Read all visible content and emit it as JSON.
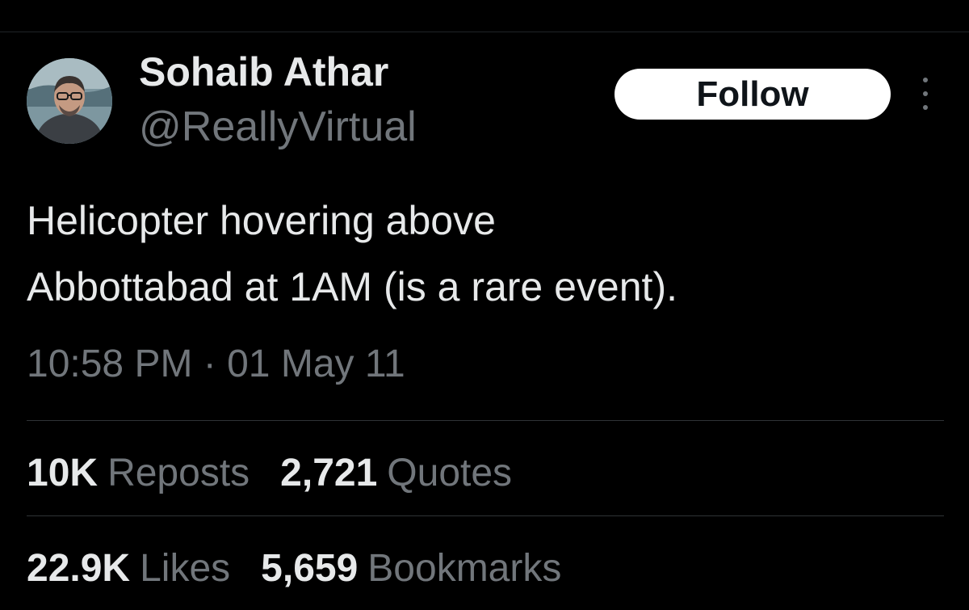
{
  "author": {
    "display_name": "Sohaib Athar",
    "handle": "@ReallyVirtual",
    "avatar_icon": "profile-photo"
  },
  "actions": {
    "follow_label": "Follow",
    "more_icon": "more-vertical-icon"
  },
  "tweet": {
    "text_lines": [
      "Helicopter hovering above",
      "Abbottabad at 1AM (is a rare event)."
    ],
    "timestamp": "10:58 PM · 01 May 11"
  },
  "stats": {
    "reposts": {
      "count": "10K",
      "label": "Reposts"
    },
    "quotes": {
      "count": "2,721",
      "label": "Quotes"
    },
    "likes": {
      "count": "22.9K",
      "label": "Likes"
    },
    "bookmarks": {
      "count": "5,659",
      "label": "Bookmarks"
    }
  },
  "colors": {
    "background": "#000000",
    "primary_text": "#e7e9ea",
    "secondary_text": "#71767b",
    "divider": "#2f3336",
    "follow_button_bg": "#ffffff",
    "follow_button_text": "#0f1419"
  }
}
